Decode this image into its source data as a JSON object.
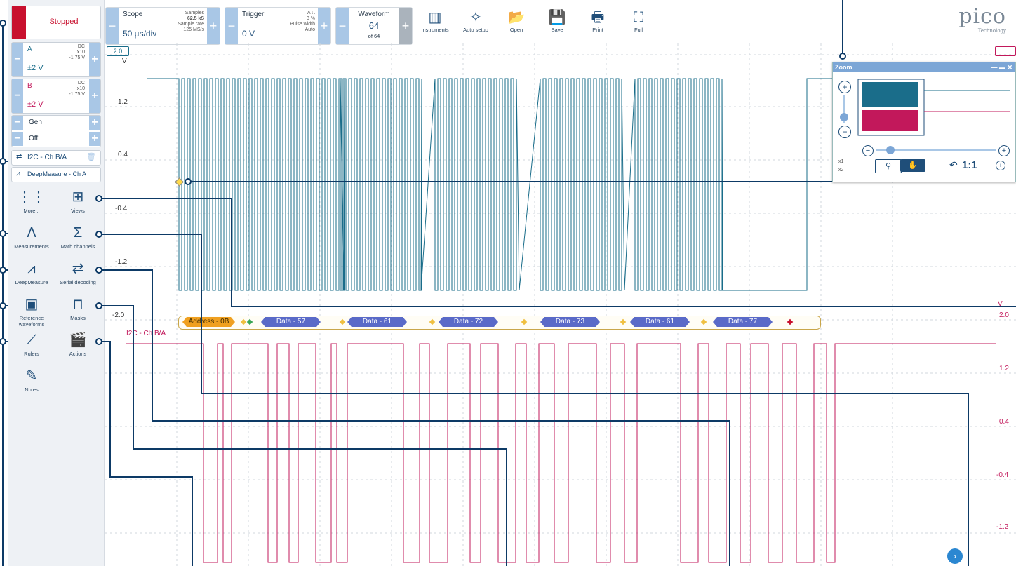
{
  "status": {
    "label": "Stopped",
    "color": "#c8102e"
  },
  "channels": [
    {
      "name": "A",
      "coupling": "DC",
      "probe": "x10",
      "offset": "-1.75 V",
      "range": "±2 V",
      "color": "#1a6d8a"
    },
    {
      "name": "B",
      "coupling": "DC",
      "probe": "x10",
      "offset": "-1.75 V",
      "range": "±2 V",
      "color": "#c2185b"
    }
  ],
  "generator": {
    "label": "Gen",
    "state": "Off"
  },
  "decoder": {
    "label": "I2C - Ch B/A"
  },
  "deepmeasure": {
    "label": "DeepMeasure - Ch A"
  },
  "tools": [
    {
      "label": "More...",
      "icon": "more-grid-icon",
      "glyph": "⋮⋮"
    },
    {
      "label": "Views",
      "icon": "views-icon",
      "glyph": "⊞"
    },
    {
      "label": "Measurements",
      "icon": "measurements-icon",
      "glyph": "Λ"
    },
    {
      "label": "Math channels",
      "icon": "sigma-icon",
      "glyph": "Σ"
    },
    {
      "label": "DeepMeasure",
      "icon": "deepmeasure-icon",
      "glyph": "⩘"
    },
    {
      "label": "Serial decoding",
      "icon": "serial-decoding-icon",
      "glyph": "⇄"
    },
    {
      "label": "Reference waveforms",
      "icon": "reference-waveforms-icon",
      "glyph": "▣"
    },
    {
      "label": "Masks",
      "icon": "masks-icon",
      "glyph": "⊓"
    },
    {
      "label": "Rulers",
      "icon": "ruler-icon",
      "glyph": "⟋"
    },
    {
      "label": "Actions",
      "icon": "actions-icon",
      "glyph": "🎬"
    },
    {
      "label": "Notes",
      "icon": "notes-icon",
      "glyph": "✎"
    }
  ],
  "scope": {
    "title": "Scope",
    "timebase": "50 µs/div",
    "samples_label": "Samples",
    "samples": "62.5 kS",
    "rate_label": "Sample rate",
    "rate": "125 MS/s"
  },
  "trigger": {
    "title": "Trigger",
    "level": "0 V",
    "channel": "A",
    "percent": "3 %",
    "type": "Pulse width",
    "mode": "Auto"
  },
  "waveform": {
    "title": "Waveform",
    "current": "64",
    "total": "of 64"
  },
  "toolbar": [
    {
      "label": "Instruments",
      "icon": "instruments-icon",
      "glyph": "▥"
    },
    {
      "label": "Auto setup",
      "icon": "auto-setup-icon",
      "glyph": "✧"
    },
    {
      "label": "Open",
      "icon": "folder-open-icon",
      "glyph": "📂"
    },
    {
      "label": "Save",
      "icon": "save-icon",
      "glyph": "💾"
    },
    {
      "label": "Print",
      "icon": "print-icon",
      "glyph": "🖶"
    },
    {
      "label": "Full",
      "icon": "fullscreen-icon",
      "glyph": "⛶"
    }
  ],
  "brand": {
    "name": "pico",
    "sub": "Technology"
  },
  "axisA": {
    "top": "2.0",
    "unit": "V",
    "ticks": [
      "1.2",
      "0.4",
      "-0.4",
      "-1.2",
      "-2.0"
    ]
  },
  "axisB": {
    "unit": "V",
    "top": "2.0",
    "ticks": [
      "1.2",
      "0.4",
      "-0.4",
      "-1.2"
    ]
  },
  "traceB_label": "I2C - Ch B/A",
  "decode": [
    {
      "label": "Address - 0B",
      "color": "#f0a020"
    },
    {
      "label": "Data - 57",
      "color": "#5a6ac8"
    },
    {
      "label": "Data - 61",
      "color": "#5a6ac8"
    },
    {
      "label": "Data - 72",
      "color": "#5a6ac8"
    },
    {
      "label": "Data - 73",
      "color": "#5a6ac8"
    },
    {
      "label": "Data - 61",
      "color": "#5a6ac8"
    },
    {
      "label": "Data - 77",
      "color": "#5a6ac8"
    }
  ],
  "zoom": {
    "title": "Zoom",
    "x1": "x1",
    "x2": "x2",
    "ratio": "1:1"
  }
}
